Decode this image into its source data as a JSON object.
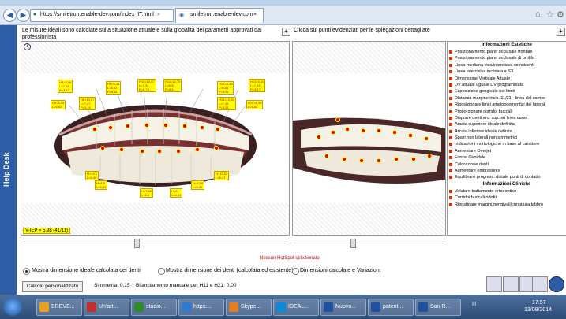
{
  "browser": {
    "url": "https://smiletron.enable-dev.com/index_IT.html",
    "tab_title": "smiletron.enable-dev.com"
  },
  "helpdesk": {
    "label": "Help Desk"
  },
  "left_panel": {
    "header": "Le misure ideali sono calcolate sulla situazione attuale e sulla globalità dei parametri approvati dal professionista",
    "iep": "V-IEP = 5,98 (41/11)",
    "labels": [
      "H8=5,18\nL=7,32\nP=3,14",
      "H9=6,43\nL=8,12\nP=5,81",
      "H10=10,67\nL=7,34\nP=8,76",
      "H11=10,75\nL=8,32\nP=8,51",
      "H12=8,43\nL=6,46\nP=5,62",
      "H13=5,19\nL=7,33\nP=3,17",
      "H5=6,35\nL=5,81",
      "H6=10,67\nL=7,47\nP=3,46",
      "H14=10,69\nL=7,46\nP=3,51",
      "H15=6,35\nL=5,82",
      "H=10,1\nL=6,49",
      "H=8,5\nL=5,33",
      "H=7,85\nL=6,8",
      "H=8\nL=4,94",
      "H=8,59\nL=5,48",
      "H=10,63\nL=6,47"
    ]
  },
  "right_panel": {
    "header": "Clicca sui punti evidenziati per le spiegazioni dettagliate",
    "hotspot_status": "Nessun HotSpot selezionato"
  },
  "info_list": {
    "section_aesthetic": "Informazioni Estetiche",
    "aesthetic_items": [
      "Posizionamento piano occlusale frontale",
      "Posizionamento piano occlusale di profilo",
      "Linea mediana viso/intercisiva coincidenti",
      "Linea intercisiva inclinata a SX",
      "Dimensione Verticale Attuale",
      "DV attuale uguale DV programmata",
      "Esposizione gengivale nei limiti",
      "Distanza margine incis. 11/21 - linea del sorriso",
      "Riposizionare limiti ameloocementizi dei laterali",
      "Proporzionare corridoi buccali",
      "Disporre denti arc. sup. su linea curva",
      "Arcata superiore ideale definita",
      "Arcata inferiore ideale definita",
      "Spazi non laterali non simmetrici",
      "Indicazioni morfologiche in base al carattere",
      "Aumentare Overjet",
      "Forma Ovoidale",
      "Colorazione denti",
      "Aumentare embrasures",
      "Equilibrare progress. distale punti di contatto"
    ],
    "section_clinical": "Informazioni Cliniche",
    "clinical_items": [
      "Valutare trattamento ortodontico",
      "Corridoi buccali ridotti",
      "Ripristinare margini gengivali/curvatura labbro"
    ]
  },
  "options": {
    "radio1": "Mostra dimensione ideale calcolata dei denti",
    "radio2": "Mostra dimensione dei denti (calcolata ed esistente)",
    "radio3": "Dimensioni calcolate e Variazioni",
    "custom_button": "Calcolo personalizzato",
    "symmetry": "Simmetria: 0,15",
    "balance": "Bilanciamento manuale per H11 e H21: 0,00"
  },
  "taskbar": {
    "tasks": [
      "BREVE...",
      "Un'art...",
      "studio...",
      "https:...",
      "Skype...",
      "IDEAL...",
      "Nuovo...",
      "patent...",
      "San R..."
    ],
    "lang": "IT",
    "time": "17:57",
    "date": "13/09/2014"
  }
}
